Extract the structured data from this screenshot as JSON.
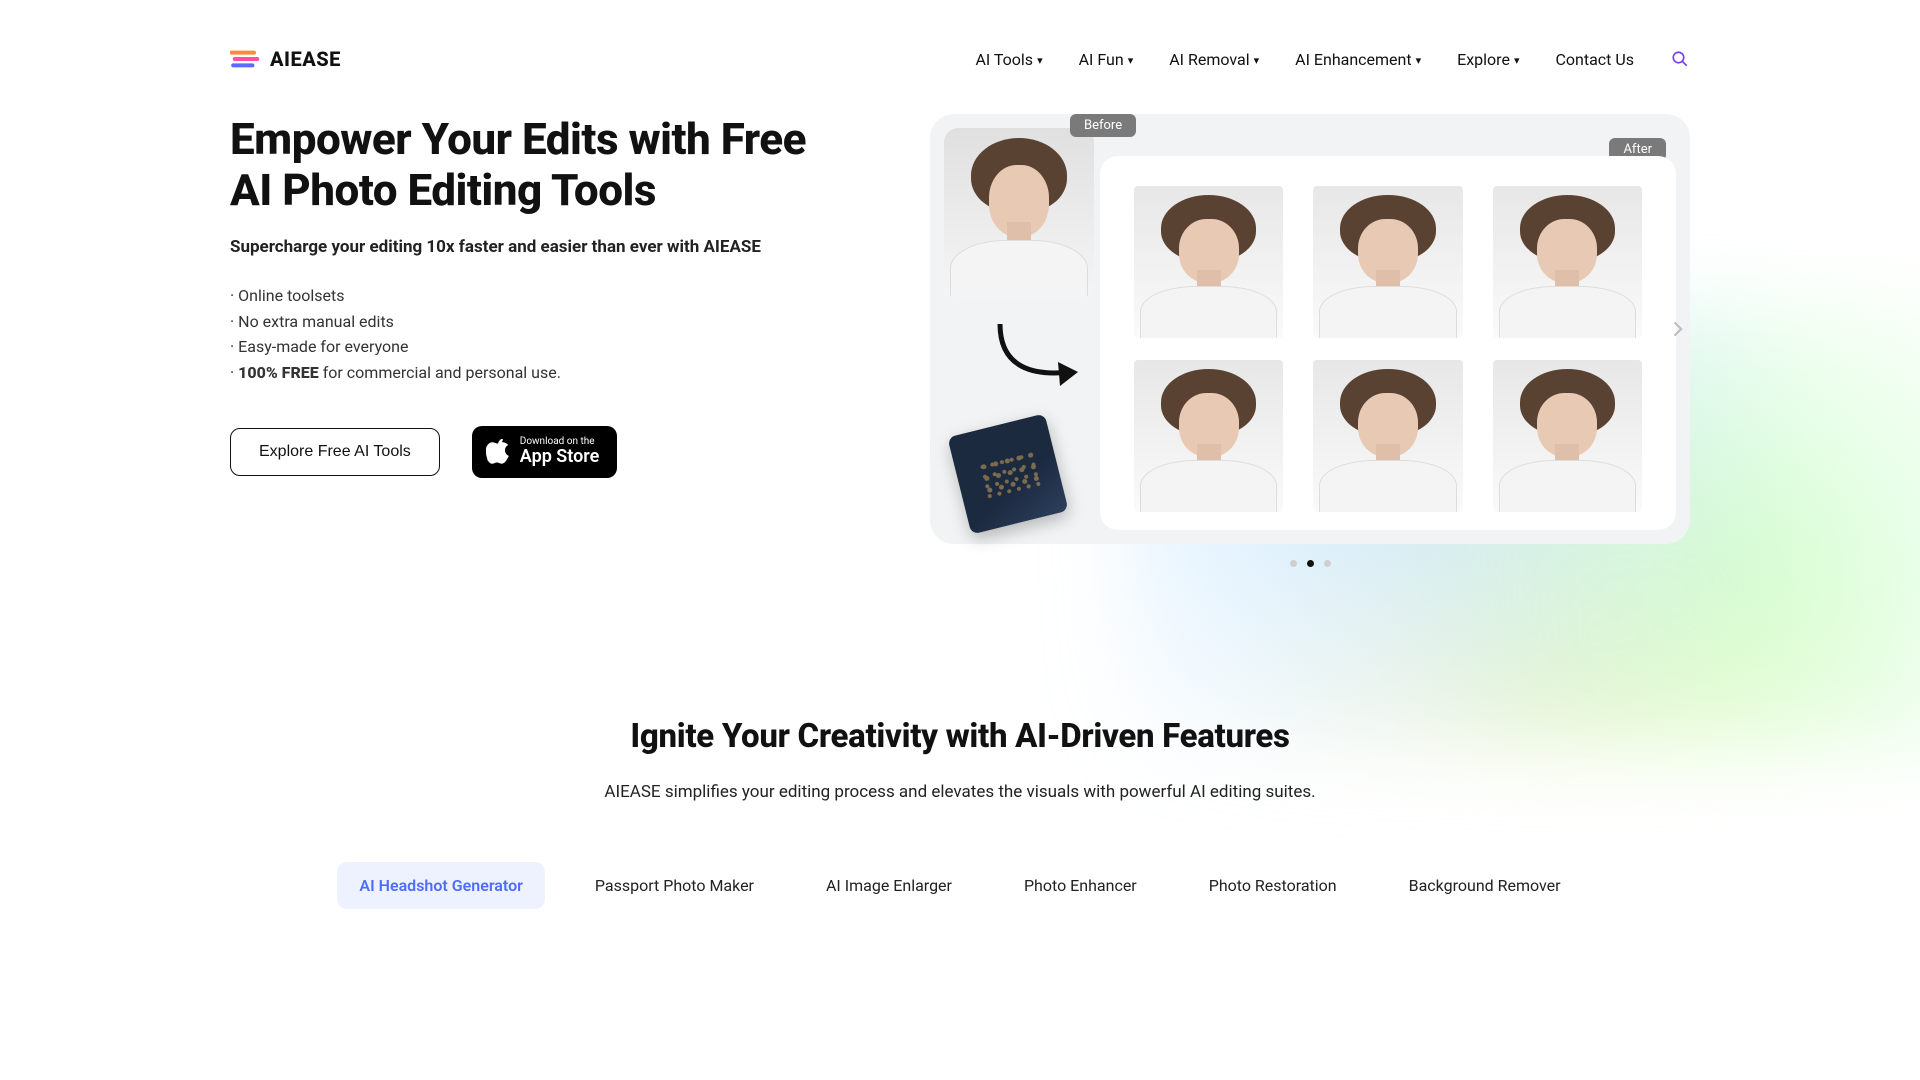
{
  "brand": {
    "name": "AIEASE"
  },
  "nav": {
    "items": [
      {
        "label": "AI Tools",
        "hasMenu": true
      },
      {
        "label": "AI Fun",
        "hasMenu": true
      },
      {
        "label": "AI Removal",
        "hasMenu": true
      },
      {
        "label": "AI Enhancement",
        "hasMenu": true
      },
      {
        "label": "Explore",
        "hasMenu": true
      },
      {
        "label": "Contact Us",
        "hasMenu": false
      }
    ]
  },
  "hero": {
    "title_line1": "Empower Your Edits with Free",
    "title_line2": "AI Photo Editing Tools",
    "subtitle": "Supercharge your editing 10x faster and easier than ever with AIEASE",
    "bullets": {
      "b1": "· Online toolsets",
      "b2": "· No extra manual edits",
      "b3": "· Easy-made for everyone",
      "b4_strong": "100% FREE",
      "b4_rest": " for commercial and personal use."
    },
    "cta_primary": "Explore Free AI Tools",
    "appstore": {
      "small": "Download on the",
      "big": "App Store"
    },
    "carousel": {
      "before_label": "Before",
      "after_label": "After",
      "active_index": 1,
      "total": 3
    }
  },
  "section2": {
    "title": "Ignite Your Creativity with AI-Driven Features",
    "subtitle": "AIEASE simplifies your editing process and elevates the visuals with powerful AI editing suites.",
    "tabs": [
      "AI Headshot Generator",
      "Passport Photo Maker",
      "AI Image Enlarger",
      "Photo Enhancer",
      "Photo Restoration",
      "Background Remover"
    ],
    "active_tab_index": 0
  }
}
